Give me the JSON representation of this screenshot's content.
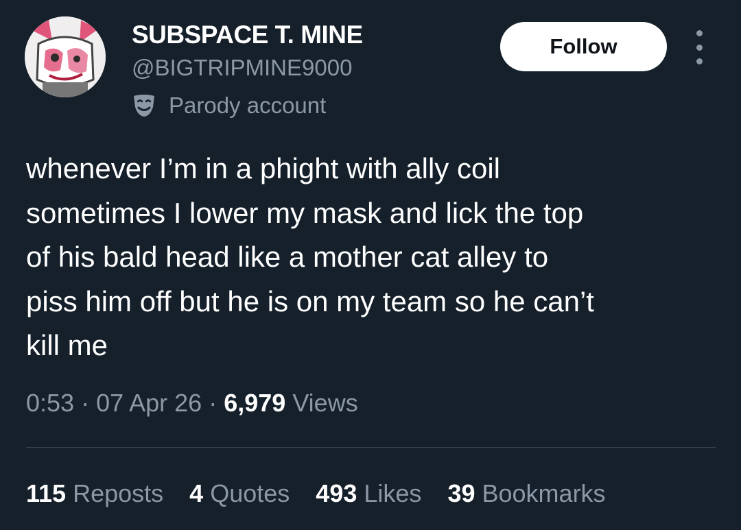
{
  "author": {
    "display_name": "SUBSPACE T. MINE",
    "handle": "@BIGTRIPMINE9000",
    "label": "Parody account"
  },
  "actions": {
    "follow_label": "Follow"
  },
  "tweet": {
    "text": "whenever I’m in a phight with ally coil\nsometimes I lower my mask and lick the top\nof his bald head like a mother cat alley to\npiss him off but he is on my team so he can’t\nkill me"
  },
  "meta": {
    "time": "0:53",
    "separator": " · ",
    "date": "07 Apr 26",
    "views_count": "6,979",
    "views_label": "Views"
  },
  "stats": [
    {
      "count": "115",
      "label": "Reposts"
    },
    {
      "count": "4",
      "label": "Quotes"
    },
    {
      "count": "493",
      "label": "Likes"
    },
    {
      "count": "39",
      "label": "Bookmarks"
    }
  ],
  "colors": {
    "background": "#15202b",
    "text_primary": "#ffffff",
    "text_secondary": "#8b98a5",
    "divider": "#38444d",
    "accent_avatar": "#e0557a"
  },
  "icons": {
    "parody": "theater-masks-icon",
    "more": "more-vertical-icon"
  }
}
